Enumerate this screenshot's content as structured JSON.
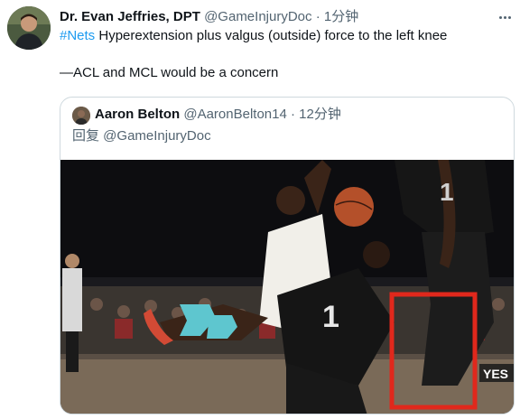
{
  "tweet": {
    "author_name": "Dr. Evan Jeffries, DPT",
    "author_handle": "@GameInjuryDoc",
    "separator": "·",
    "time": "1分钟",
    "hashtag": "#Nets",
    "text_line1_rest": " Hyperextension plus valgus (outside) force to the left knee",
    "text_line2": "—ACL and MCL would be a concern"
  },
  "quoted": {
    "author_name": "Aaron Belton",
    "author_handle": "@AaronBelton14",
    "separator": "·",
    "time": "12分钟",
    "reply_prefix": "回复 ",
    "reply_mention": "@GameInjuryDoc",
    "media": {
      "watermark": "YES",
      "highlight_color": "#e0281c"
    }
  },
  "colors": {
    "link": "#1d9bf0",
    "secondary_text": "#536471",
    "border": "#cfd9de"
  }
}
